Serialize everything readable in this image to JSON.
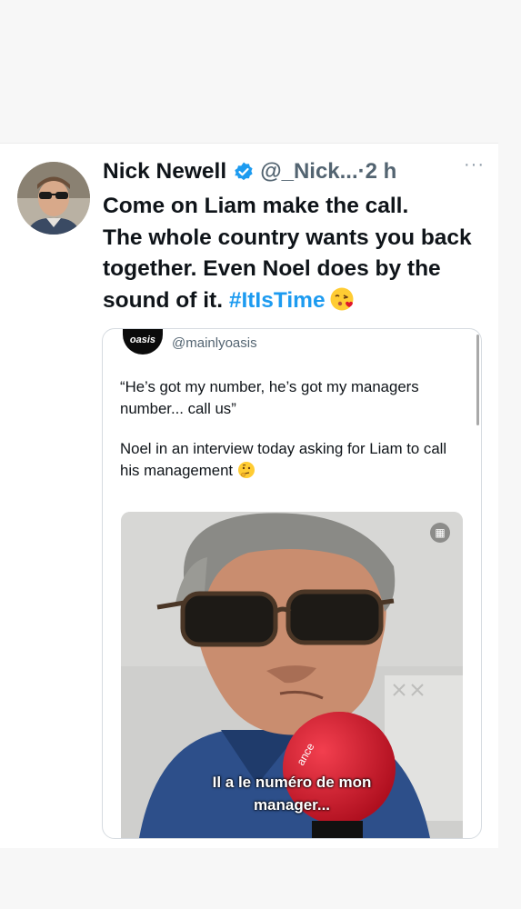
{
  "tweet": {
    "author_name": "Nick Newell",
    "handle": "@_Nick...",
    "time": "·2 h",
    "more": "···",
    "text_before_hashtag": "Come on Liam make the call.\nThe whole country wants you back together. Even Noel does by the sound of it. ",
    "hashtag": "#ItIsTime",
    "emoji": "face-blowing-a-kiss"
  },
  "quote": {
    "avatar_text": "oasis",
    "handle": "@mainlyoasis",
    "quote_line": "“He’s got my number, he’s got my managers number... call us”",
    "caption": "Noel in an interview today asking for Liam to call his management",
    "caption_emoji": "thinking-face",
    "media": {
      "subtitle_line1": "Il a le numéro de mon",
      "subtitle_line2": "manager...",
      "corner_icon": "image-icon"
    }
  },
  "colors": {
    "accent": "#1d9bf0",
    "text": "#0f1419",
    "secondary": "#536471",
    "microphone": "#e0162b"
  }
}
